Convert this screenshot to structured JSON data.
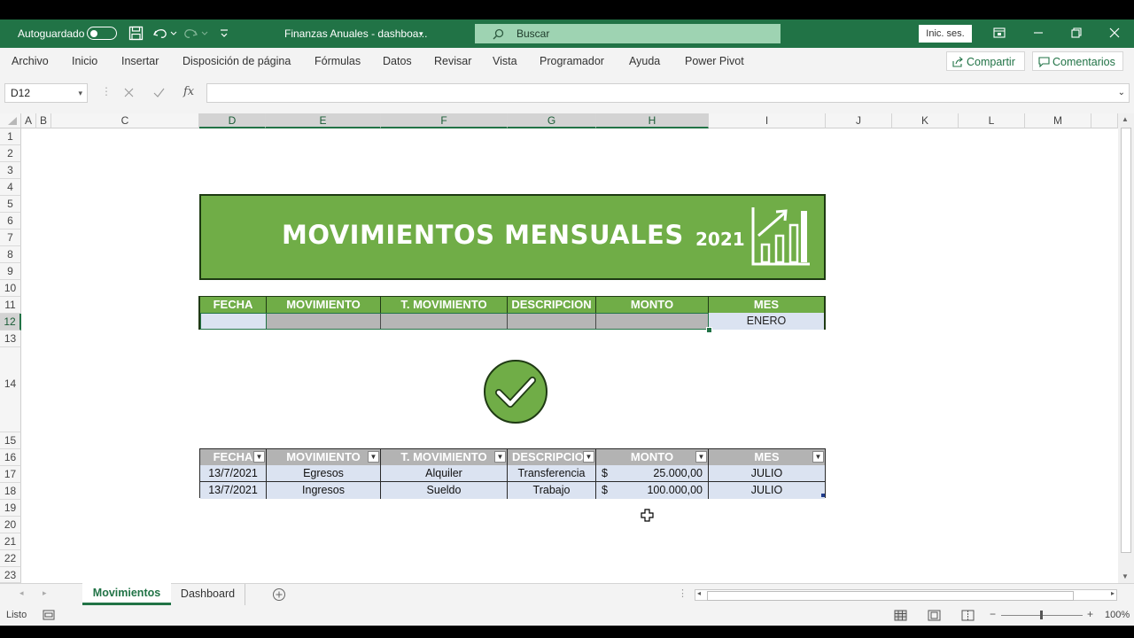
{
  "titlebar": {
    "autosave_label": "Autoguardado",
    "doc_title": "Finanzas Anuales - dashboa...",
    "search_placeholder": "Buscar",
    "signin_label": "Inic. ses."
  },
  "ribbon": {
    "tabs": [
      "Archivo",
      "Inicio",
      "Insertar",
      "Disposición de página",
      "Fórmulas",
      "Datos",
      "Revisar",
      "Vista",
      "Programador",
      "Ayuda",
      "Power Pivot"
    ],
    "share_label": "Compartir",
    "comments_label": "Comentarios"
  },
  "formula_bar": {
    "name_box": "D12",
    "fx_label": "fx",
    "value": ""
  },
  "columns": [
    "A",
    "B",
    "C",
    "D",
    "E",
    "F",
    "G",
    "H",
    "I",
    "J",
    "K",
    "L",
    "M"
  ],
  "rows": [
    "1",
    "2",
    "3",
    "4",
    "5",
    "6",
    "7",
    "8",
    "9",
    "10",
    "11",
    "12",
    "13",
    "14",
    "15",
    "16",
    "17",
    "18",
    "19",
    "20",
    "21",
    "22",
    "23"
  ],
  "banner": {
    "title": "MOVIMIENTOS MENSUALES",
    "year": "2021"
  },
  "form_table": {
    "headers": [
      "FECHA",
      "MOVIMIENTO",
      "T. MOVIMIENTO",
      "DESCRIPCION",
      "MONTO",
      "MES"
    ],
    "mes_value": "ENERO"
  },
  "data_table": {
    "headers": [
      "FECHA",
      "MOVIMIENTO",
      "T. MOVIMIENTO",
      "DESCRIPCIO",
      "MONTO",
      "MES"
    ],
    "rows": [
      {
        "fecha": "13/7/2021",
        "movimiento": "Egresos",
        "tipo": "Alquiler",
        "descripcion": "Transferencia",
        "moneda": "$",
        "monto": "25.000,00",
        "mes": "JULIO"
      },
      {
        "fecha": "13/7/2021",
        "movimiento": "Ingresos",
        "tipo": "Sueldo",
        "descripcion": "Trabajo",
        "moneda": "$",
        "monto": "100.000,00",
        "mes": "JULIO"
      }
    ]
  },
  "sheets": {
    "tabs": [
      "Movimientos",
      "Dashboard"
    ],
    "active": "Movimientos"
  },
  "status": {
    "ready": "Listo",
    "zoom": "100%"
  },
  "colors": {
    "excel_green": "#217346",
    "banner_green": "#70ad47",
    "light_blue": "#dbe3f1",
    "header_gray": "#b3b3b3"
  }
}
